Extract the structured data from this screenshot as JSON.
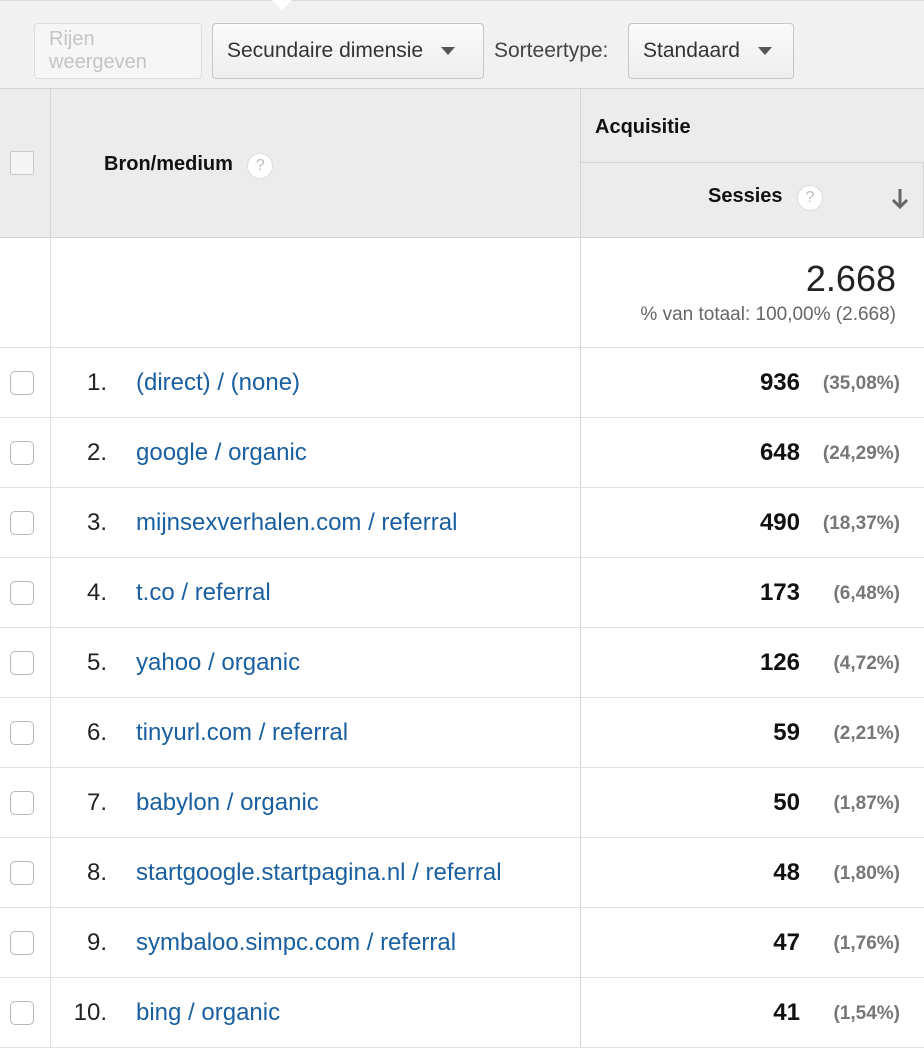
{
  "toolbar": {
    "show_rows": "Rijen weergeven",
    "secondary_dimension": "Secundaire dimensie",
    "sort_type_label": "Sorteertype:",
    "sort_type_value": "Standaard"
  },
  "table": {
    "dimension_header": "Bron/medium",
    "group_header": "Acquisitie",
    "metric_header": "Sessies",
    "help_glyph": "?",
    "sort_icon": "arrow-down",
    "total_value": "2.668",
    "total_subtext": "% van totaal: 100,00% (2.668)",
    "rows": [
      {
        "rank": "1.",
        "label": "(direct) / (none)",
        "value": "936",
        "pct": "(35,08%)"
      },
      {
        "rank": "2.",
        "label": "google / organic",
        "value": "648",
        "pct": "(24,29%)"
      },
      {
        "rank": "3.",
        "label": "mijnsexverhalen.com / referral",
        "value": "490",
        "pct": "(18,37%)"
      },
      {
        "rank": "4.",
        "label": "t.co / referral",
        "value": "173",
        "pct": "(6,48%)"
      },
      {
        "rank": "5.",
        "label": "yahoo / organic",
        "value": "126",
        "pct": "(4,72%)"
      },
      {
        "rank": "6.",
        "label": "tinyurl.com / referral",
        "value": "59",
        "pct": "(2,21%)"
      },
      {
        "rank": "7.",
        "label": "babylon / organic",
        "value": "50",
        "pct": "(1,87%)"
      },
      {
        "rank": "8.",
        "label": "startgoogle.startpagina.nl / referral",
        "value": "48",
        "pct": "(1,80%)"
      },
      {
        "rank": "9.",
        "label": "symbaloo.simpc.com / referral",
        "value": "47",
        "pct": "(1,76%)"
      },
      {
        "rank": "10.",
        "label": "bing / organic",
        "value": "41",
        "pct": "(1,54%)"
      }
    ]
  },
  "colors": {
    "link": "#1a5fa0",
    "header_bg": "#ececec",
    "toolbar_bg": "#f1f1f1"
  }
}
